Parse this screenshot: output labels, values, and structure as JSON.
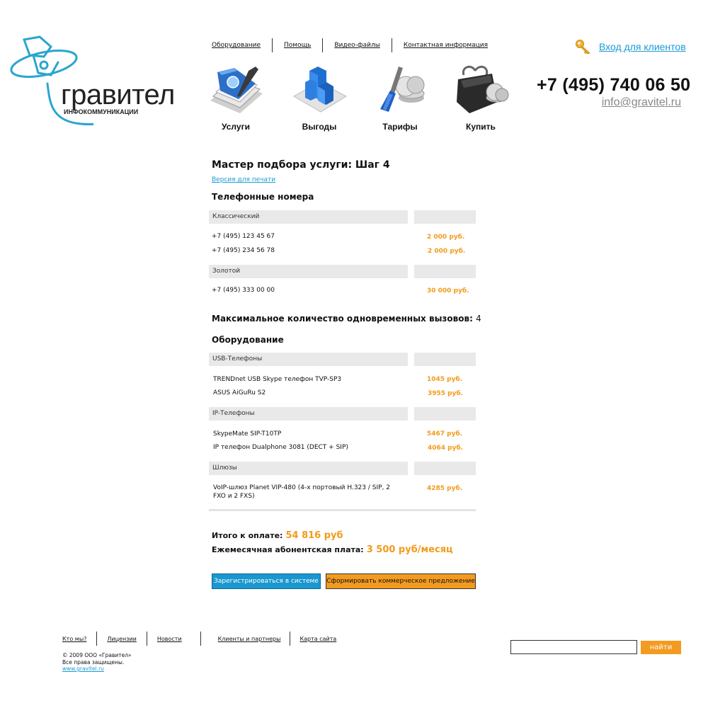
{
  "brand": {
    "name": "гравител",
    "tagline": "ИНФОКОММУНИКАЦИИ"
  },
  "top_nav": [
    "Оборудование",
    "Помощь",
    "Видео-файлы",
    "Контактная информация"
  ],
  "login": {
    "label": "Вход для клиентов",
    "icon": "key-icon"
  },
  "contact": {
    "phone": "+7 (495) 740 06 50",
    "email": "info@gravitel.ru"
  },
  "main_nav": [
    {
      "label": "Услуги",
      "icon": "book-icon"
    },
    {
      "label": "Выгоды",
      "icon": "blocks-icon"
    },
    {
      "label": "Тарифы",
      "icon": "screwdriver-coins-icon"
    },
    {
      "label": "Купить",
      "icon": "wallet-icon"
    }
  ],
  "page": {
    "title": "Мастер подбора услуги: Шаг 4",
    "print_link": "Версия для печати"
  },
  "phones": {
    "heading": "Телефонные номера",
    "groups": [
      {
        "name": "Классический",
        "items": [
          {
            "label": "+7 (495) 123 45 67",
            "price": "2 000 руб."
          },
          {
            "label": "+7 (495) 234 56 78",
            "price": "2 000 руб."
          }
        ]
      },
      {
        "name": "Золотой",
        "items": [
          {
            "label": "+7 (495) 333 00 00",
            "price": "30 000 руб."
          }
        ]
      }
    ]
  },
  "max_calls": {
    "label": "Максимальное количество одновременных вызовов:",
    "value": "4"
  },
  "equipment": {
    "heading": "Оборудование",
    "groups": [
      {
        "name": "USB-Телефоны",
        "items": [
          {
            "label": "TRENDnet USB Skype телефон TVP-SP3",
            "price": "1045 руб."
          },
          {
            "label": "ASUS AiGuRu S2",
            "price": "3955 руб."
          }
        ]
      },
      {
        "name": "IP-Телефоны",
        "items": [
          {
            "label": "SkypeMate SIP-T10TP",
            "price": "5467 руб."
          },
          {
            "label": "IP телефон Dualphone 3081 (DECT + SIP)",
            "price": "4064 руб."
          }
        ]
      },
      {
        "name": "Шлюзы",
        "items": [
          {
            "label": "VoIP-шлюз Planet VIP-480 (4-х портовый H.323 / SIP, 2",
            "label2": "FXO и 2 FXS)",
            "price": "4285 руб."
          }
        ]
      }
    ]
  },
  "totals": {
    "due_label": "Итого к оплате:",
    "due_value": "54 816 руб",
    "monthly_label": "Ежемесячная абонентская плата:",
    "monthly_value": "3 500 руб/месяц"
  },
  "buttons": {
    "register": "Зарегистрироваться в системе",
    "offer": "Сформировать коммерческое предложение"
  },
  "footer": {
    "nav": [
      "Кто мы?",
      "Лицензии",
      "Новости",
      "Клиенты и партнеры",
      "Карта сайта"
    ],
    "copyright": "© 2009 ООО «Гравител»",
    "rights": "Все права защищены.",
    "site": "www.gravitel.ru",
    "search_button": "найти"
  },
  "colors": {
    "accent_blue": "#1a97cf",
    "accent_orange": "#f39b20",
    "logo_blue": "#2aa6cf"
  }
}
